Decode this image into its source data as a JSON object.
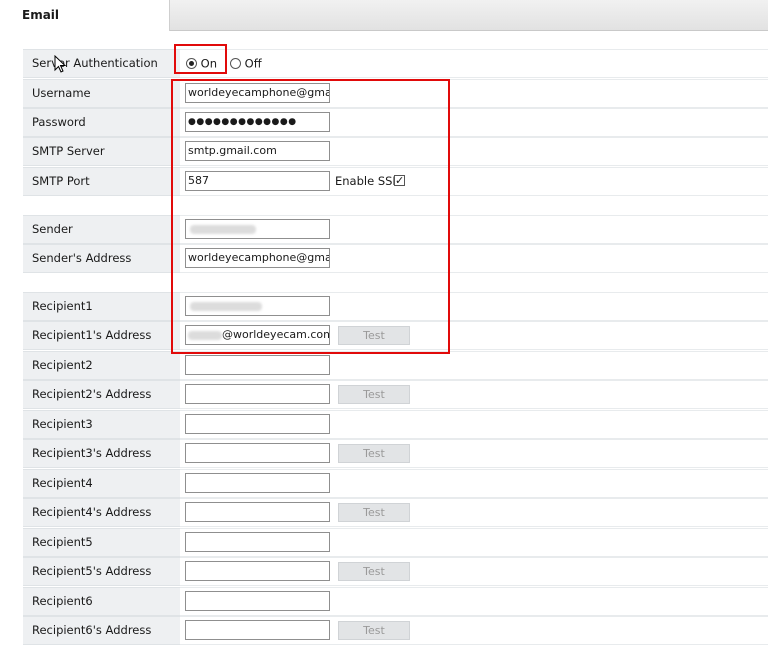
{
  "tab": {
    "title": "Email"
  },
  "auth": {
    "label": "Server Authentication",
    "on_label": "On",
    "off_label": "Off",
    "selected": "On"
  },
  "username": {
    "label": "Username",
    "value": "worldeyecamphone@gma"
  },
  "password": {
    "label": "Password",
    "value": "●●●●●●●●●●●●●"
  },
  "smtp_server": {
    "label": "SMTP Server",
    "value": "smtp.gmail.com"
  },
  "smtp_port": {
    "label": "SMTP Port",
    "value": "587",
    "ssl_label": "Enable SSL",
    "ssl_checked": true
  },
  "sender": {
    "label": "Sender",
    "value": ""
  },
  "sender_address": {
    "label": "Sender's Address",
    "value": "worldeyecamphone@gma"
  },
  "test_label": "Test",
  "recipients": [
    {
      "name_label": "Recipient1",
      "address_label": "Recipient1's Address",
      "address_value": "@worldeyecam.com"
    },
    {
      "name_label": "Recipient2",
      "address_label": "Recipient2's Address",
      "address_value": ""
    },
    {
      "name_label": "Recipient3",
      "address_label": "Recipient3's Address",
      "address_value": ""
    },
    {
      "name_label": "Recipient4",
      "address_label": "Recipient4's Address",
      "address_value": ""
    },
    {
      "name_label": "Recipient5",
      "address_label": "Recipient5's Address",
      "address_value": ""
    },
    {
      "name_label": "Recipient6",
      "address_label": "Recipient6's Address",
      "address_value": ""
    }
  ],
  "colors": {
    "highlight": "#e10a0a",
    "label_bg": "#eef0f2"
  }
}
